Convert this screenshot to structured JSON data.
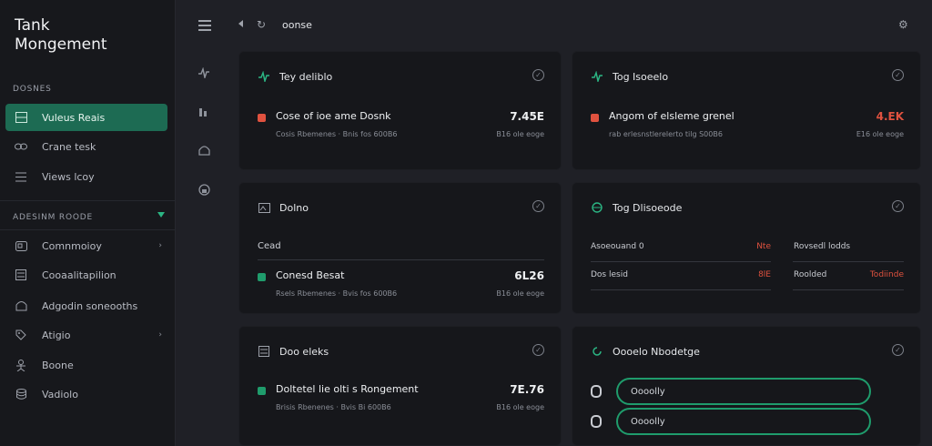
{
  "app": {
    "title": "Tank\nMongement"
  },
  "sidebar": {
    "section1": "Dosnes",
    "items1": [
      {
        "label": "Vuleus Reais",
        "icon": "list-icon",
        "active": true
      },
      {
        "label": "Crane tesk",
        "icon": "link-icon",
        "active": false
      },
      {
        "label": "Views lcoy",
        "icon": "lines-icon",
        "active": false
      }
    ],
    "section2": "Adesinm Roode",
    "items2": [
      {
        "label": "Comnmoioy",
        "icon": "grid-icon",
        "caret": "›"
      },
      {
        "label": "Cooaalitapilion",
        "icon": "doc-icon",
        "caret": ""
      },
      {
        "label": "Adgodin soneooths",
        "icon": "shield-icon",
        "caret": ""
      },
      {
        "label": "Atigio",
        "icon": "tag-icon",
        "caret": "›"
      },
      {
        "label": "Boone",
        "icon": "person-icon",
        "caret": ""
      },
      {
        "label": "Vadiolo",
        "icon": "stack-icon",
        "caret": ""
      }
    ]
  },
  "topbar": {
    "breadcrumb": "oonse"
  },
  "cards": {
    "c1": {
      "title": "Tey deliblo",
      "task": {
        "title": "Cose of ioe ame Dosnk",
        "meta": "Cosis Rbemenes  ·  Bnis  fos  600B6",
        "value": "7.45E",
        "sub": "B16  ole  eoge"
      }
    },
    "c2": {
      "title": "Tog Isoeelo",
      "task": {
        "title": "Angom of elsleme grenel",
        "meta": "rab  erlesnstlerelerto  tilg  S00B6",
        "value": "4.EK",
        "sub": "E16  ole  eoge"
      }
    },
    "c3": {
      "title": "Dolno",
      "sublabel": "Cead",
      "task": {
        "title": "Conesd Besat",
        "meta": "Rsels  Rbemenes  ·  Bvis  fos  600B6",
        "value": "6L26",
        "sub": "B16  ole  eoge"
      }
    },
    "c4": {
      "title": "Tog Dlisoeode",
      "rows": [
        {
          "a": "Asoeouand  0",
          "av": "Nte",
          "b": "Rovsedl lodds",
          "bv": ""
        },
        {
          "a": "Dos  lesid",
          "av": "8lE",
          "b": "Roolded",
          "bv": "Todiinde"
        }
      ]
    },
    "c5": {
      "title": "Doo eleks",
      "task": {
        "title": "Doltetel lie olti s Rongement",
        "meta": "Brisis Rbenenes  ·  Bvis  Bi  600B6",
        "value": "7E.76",
        "sub": "B16  ole  eoge"
      }
    },
    "c6": {
      "title": "Oooelo Nbodetge",
      "pills": [
        "Oooolly",
        "Oooolly"
      ]
    }
  },
  "colors": {
    "accent": "#1f9c6c",
    "active_bg": "#1d6b53",
    "danger": "#e0523f"
  }
}
